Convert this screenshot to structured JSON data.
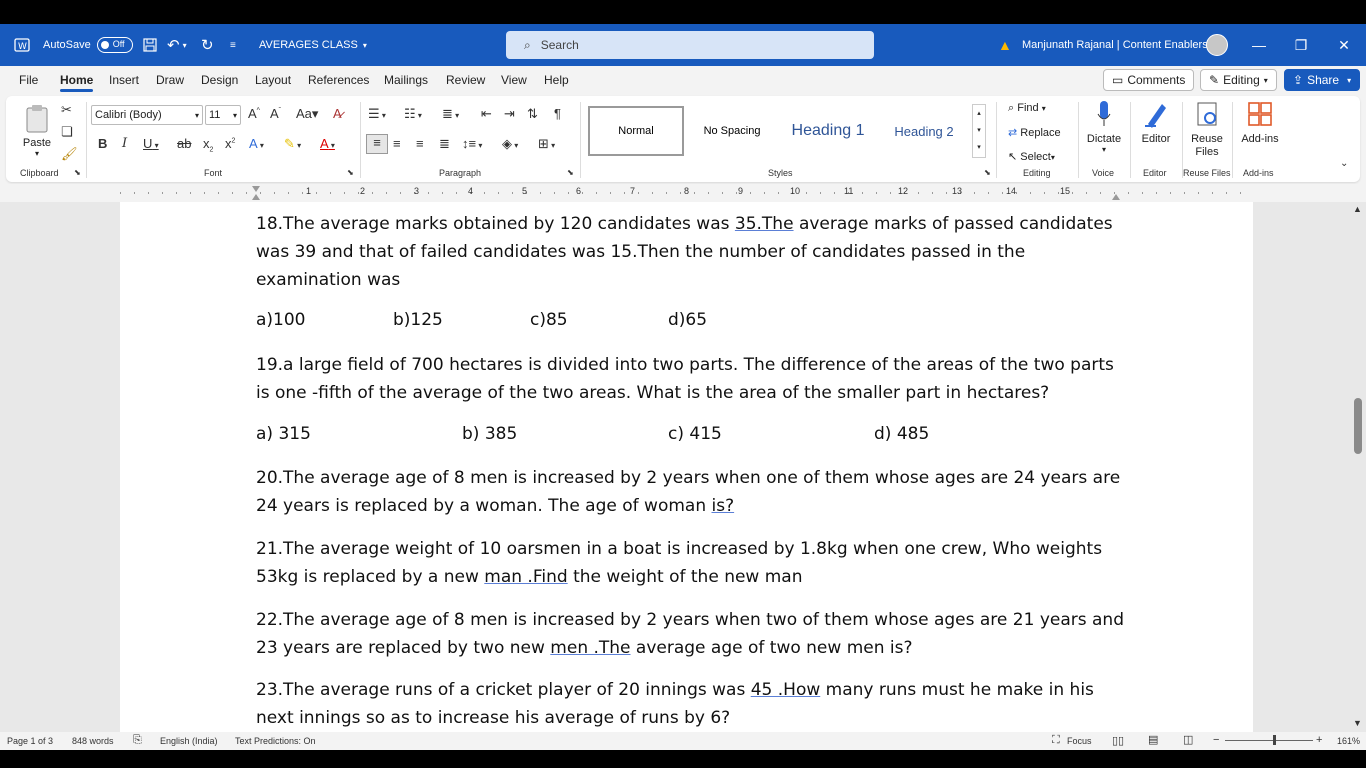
{
  "titlebar": {
    "autosave_label": "AutoSave",
    "autosave_state": "Off",
    "doc_title": "AVERAGES CLASS",
    "search_placeholder": "Search",
    "user_name": "Manjunath Rajanal | Content Enablers"
  },
  "tabs": [
    "File",
    "Home",
    "Insert",
    "Draw",
    "Design",
    "Layout",
    "References",
    "Mailings",
    "Review",
    "View",
    "Help"
  ],
  "tabs_right": {
    "comments": "Comments",
    "editing": "Editing",
    "share": "Share"
  },
  "ribbon": {
    "paste": "Paste",
    "font_name": "Calibri (Body)",
    "font_size": "11",
    "styles": [
      "Normal",
      "No Spacing",
      "Heading 1",
      "Heading 2"
    ],
    "find": "Find",
    "replace": "Replace",
    "select": "Select",
    "dictate": "Dictate",
    "editor": "Editor",
    "reuse_files": "Reuse Files",
    "addins": "Add-ins",
    "group_labels": [
      "Clipboard",
      "Font",
      "Paragraph",
      "Styles",
      "Editing",
      "Voice",
      "Editor",
      "Reuse Files",
      "Add-ins"
    ]
  },
  "ruler_numbers": [
    "1",
    "2",
    "3",
    "4",
    "5",
    "6",
    "7",
    "8",
    "9",
    "10",
    "11",
    "12",
    "13",
    "14",
    "15"
  ],
  "document": {
    "q18": {
      "pre": "18.The average marks obtained by 120 candidates was ",
      "u": "35.The",
      "post": " average marks of passed candidates was 39 and that of failed candidates was 15.Then the number of candidates passed in the examination was"
    },
    "q18_options": [
      "a)100",
      "b)125",
      "c)85",
      "d)65"
    ],
    "q19": "19.a large field of 700 hectares is divided into two parts. The difference of the areas of the two parts is one -fifth of the average of the two areas. What is the area of the smaller part in hectares?",
    "q19_options": [
      "a) 315",
      "b) 385",
      "c) 415",
      "d) 485"
    ],
    "q20": {
      "pre": "20.The average age of 8 men is increased by 2 years when one of them whose ages are 24 years are 24 years is replaced by a woman. The age of woman ",
      "u": "is?"
    },
    "q21": {
      "pre": "21.The average weight of 10 oarsmen in a boat is increased by 1.8kg when one crew, Who weights 53kg is replaced by a new ",
      "u": "man .Find",
      "post": " the weight of the new man"
    },
    "q22": {
      "pre": "22.The average age of 8 men is increased by 2 years when two of them whose ages are 21 years and 23 years are replaced by two new ",
      "u": "men .The",
      "post": " average age of two new men is?"
    },
    "q23": {
      "pre": "23.The average runs of a cricket player of 20 innings was ",
      "u": "45 .How",
      "post": " many runs must he make in his next innings so as to increase his average of runs by 6?"
    }
  },
  "status": {
    "page": "Page 1 of 3",
    "words": "848 words",
    "language": "English (India)",
    "predictions": "Text Predictions: On",
    "focus": "Focus",
    "zoom": "161%"
  },
  "colors": {
    "brand": "#185abd",
    "heading": "#2f5597"
  }
}
